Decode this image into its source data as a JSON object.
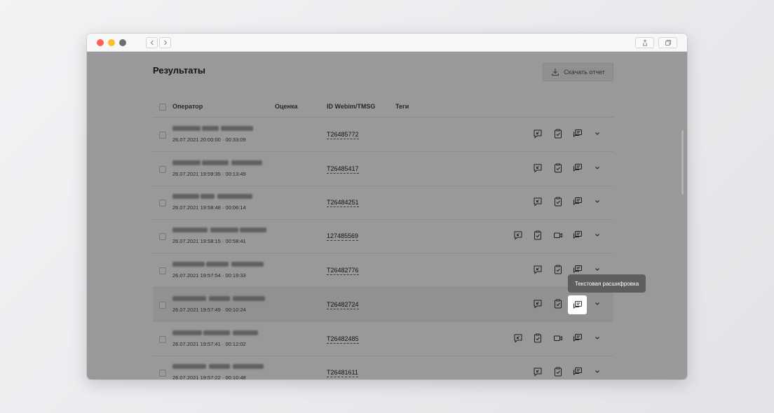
{
  "page": {
    "title": "Результаты",
    "download_button": "Скачать отчет",
    "tooltip": "Текстовая расшифровка"
  },
  "table": {
    "columns": [
      "Оператор",
      "Оценка",
      "ID Webim/TMSG",
      "Теги"
    ],
    "rows": [
      {
        "timestamp": "26.07.2021 20:00:00 · 00:33:09",
        "id": "T26485772",
        "video": false
      },
      {
        "timestamp": "26.07.2021 19:59:35 · 00:13:49",
        "id": "T26485417",
        "video": false
      },
      {
        "timestamp": "26.07.2021 19:58:48 · 00:06:14",
        "id": "T26484251",
        "video": false
      },
      {
        "timestamp": "26.07.2021 19:58:15 · 00:58:41",
        "id": "127485569",
        "video": true
      },
      {
        "timestamp": "26.07.2021 19:57:54 · 00:19:33",
        "id": "T26482776",
        "video": false
      },
      {
        "timestamp": "26.07.2021 19:57:49 · 00:10:24",
        "id": "T26482724",
        "video": false,
        "highlighted": true
      },
      {
        "timestamp": "26.07.2021 19:57:41 · 00:12:02",
        "id": "T26482485",
        "video": true
      },
      {
        "timestamp": "26.07.2021 19:57:22 · 00:10:48",
        "id": "T26481611",
        "video": false
      }
    ]
  },
  "icons": [
    "comment-icon",
    "clipboard-check-icon",
    "video-icon",
    "transcript-icon",
    "chevron-down-icon"
  ],
  "colors": {
    "overlay": "#000000",
    "tooltip": "#5e5e5e",
    "traffic_red": "#fe5f57",
    "traffic_yellow": "#febc2e"
  }
}
